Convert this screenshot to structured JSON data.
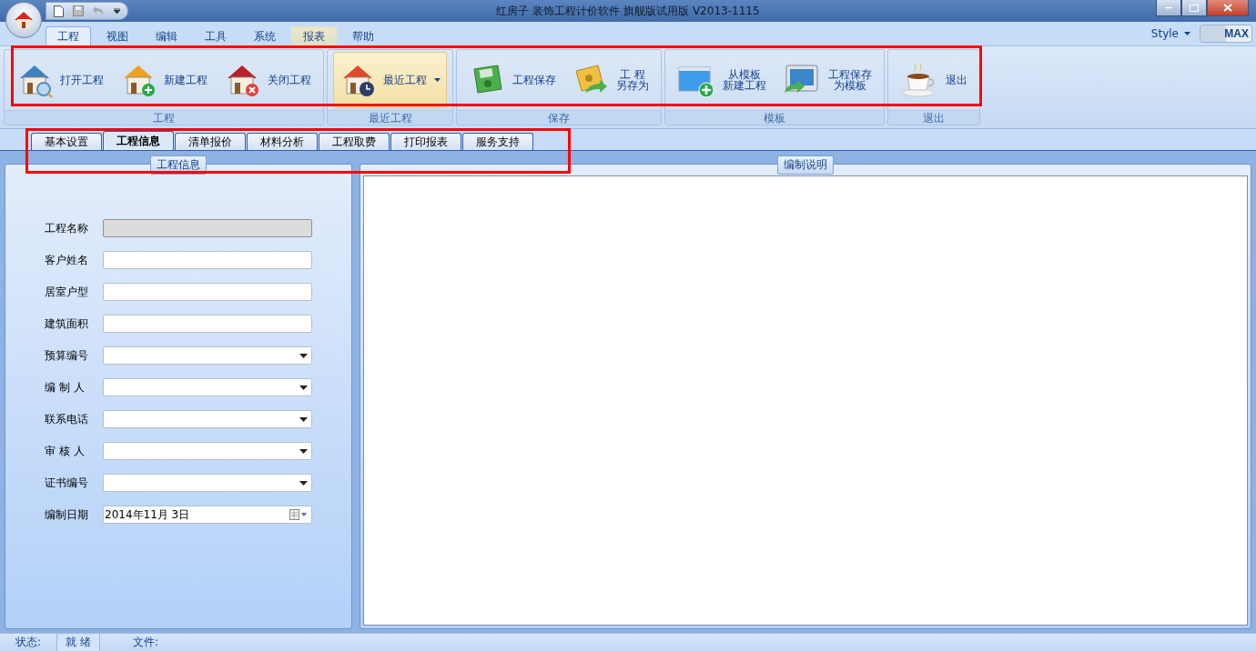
{
  "window": {
    "title": "红房子 装饰工程计价软件 旗舰版试用版 V2013-1115"
  },
  "menu_tabs": [
    {
      "label": "工程",
      "selected": true,
      "kind": "normal"
    },
    {
      "label": "视图",
      "selected": false,
      "kind": "normal"
    },
    {
      "label": "编辑",
      "selected": false,
      "kind": "normal"
    },
    {
      "label": "工具",
      "selected": false,
      "kind": "normal"
    },
    {
      "label": "系统",
      "selected": false,
      "kind": "normal"
    },
    {
      "label": "报表",
      "selected": false,
      "kind": "contextual"
    },
    {
      "label": "帮助",
      "selected": false,
      "kind": "normal"
    }
  ],
  "style_menu": {
    "label": "Style"
  },
  "max_button": {
    "label": "MAX"
  },
  "ribbon_groups": [
    {
      "label": "工程",
      "buttons": [
        {
          "lines": [
            "打开工程"
          ],
          "kind": "house-search",
          "highlighted": false
        },
        {
          "lines": [
            "新建工程"
          ],
          "kind": "house-add",
          "highlighted": false
        },
        {
          "lines": [
            "关闭工程"
          ],
          "kind": "house-close",
          "highlighted": false
        }
      ]
    },
    {
      "label": "最近工程",
      "buttons": [
        {
          "lines": [
            "最近工程"
          ],
          "kind": "house-clock",
          "highlighted": true,
          "dropdown": true
        }
      ]
    },
    {
      "label": "保存",
      "buttons": [
        {
          "lines": [
            "工程保存"
          ],
          "kind": "disk",
          "highlighted": false
        },
        {
          "lines": [
            "工 程",
            "另存为"
          ],
          "kind": "disk-arrow",
          "highlighted": false
        }
      ]
    },
    {
      "label": "模板",
      "buttons": [
        {
          "lines": [
            "从模板",
            "新建工程"
          ],
          "kind": "window-add",
          "highlighted": false
        },
        {
          "lines": [
            "工程保存",
            "为模板"
          ],
          "kind": "monitor-arrow",
          "highlighted": false
        }
      ]
    },
    {
      "label": "退出",
      "buttons": [
        {
          "lines": [
            "退出"
          ],
          "kind": "cup",
          "highlighted": false
        }
      ]
    }
  ],
  "doc_tabs": [
    {
      "label": "基本设置",
      "selected": false
    },
    {
      "label": "工程信息",
      "selected": true
    },
    {
      "label": "清单报价",
      "selected": false
    },
    {
      "label": "材料分析",
      "selected": false
    },
    {
      "label": "工程取费",
      "selected": false
    },
    {
      "label": "打印报表",
      "selected": false
    },
    {
      "label": "服务支持",
      "selected": false
    }
  ],
  "project_info": {
    "title": "工程信息",
    "fields": [
      {
        "label": "工程名称",
        "kind": "text",
        "disabled": true
      },
      {
        "label": "客户姓名",
        "kind": "text",
        "disabled": false
      },
      {
        "label": "居室户型",
        "kind": "text",
        "disabled": false
      },
      {
        "label": "建筑面积",
        "kind": "text",
        "disabled": false
      },
      {
        "label": "预算编号",
        "kind": "combo",
        "disabled": false
      },
      {
        "label": "编 制 人",
        "kind": "combo",
        "disabled": false
      },
      {
        "label": "联系电话",
        "kind": "combo",
        "disabled": false
      },
      {
        "label": "审 核 人",
        "kind": "combo",
        "disabled": false
      },
      {
        "label": "证书编号",
        "kind": "combo",
        "disabled": false
      },
      {
        "label": "编制日期",
        "kind": "date",
        "disabled": false,
        "value": "2014年11月 3日"
      }
    ]
  },
  "notes": {
    "title": "编制说明"
  },
  "status_bar": {
    "status_label": "状态:",
    "status": "就 绪",
    "file_label": "文件:"
  }
}
